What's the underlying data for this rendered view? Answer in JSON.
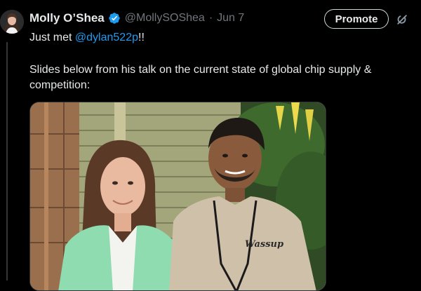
{
  "tweet": {
    "author_name": "Molly O’Shea",
    "handle": "@MollySOShea",
    "separator": "·",
    "date": "Jun 7",
    "text_prefix": "Just met ",
    "mention": "@dylan522p",
    "text_suffix": "!!",
    "body": "Slides below from his talk on the current state of global chip supply & competition:",
    "shirt_text": "Wassup",
    "verified_color": "#1d9bf0",
    "avatar_icon": "profile-avatar",
    "verified_icon": "verified-badge-icon",
    "more_icon": "grok-icon"
  },
  "actions": {
    "promote_label": "Promote"
  }
}
